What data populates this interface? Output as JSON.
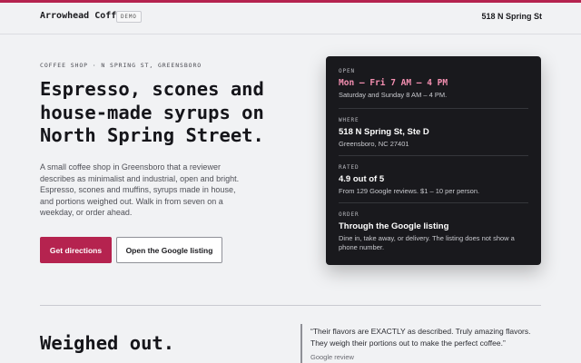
{
  "colors": {
    "accent": "#b5234f",
    "hours_accent": "#f48fb1",
    "card_bg": "#19191d",
    "page_bg": "#f1f2f4"
  },
  "header": {
    "brand": "Arrowhead Coffee",
    "badge": "DEMO",
    "address": "518 N Spring St"
  },
  "hero": {
    "eyebrow": "COFFEE SHOP · N SPRING ST, GREENSBORO",
    "headline": "Espresso, scones and house-made syrups on North Spring Street.",
    "description": "A small coffee shop in Greensboro that a reviewer describes as minimalist and industrial, open and bright. Espresso, scones and muffins, syrups made in house, and portions weighed out. Walk in from seven on a weekday, or order ahead.",
    "primary_button": "Get directions",
    "secondary_button": "Open the Google listing"
  },
  "info_card": {
    "open": {
      "label": "OPEN",
      "main": "Mon – Fri 7 AM – 4 PM",
      "sub": "Saturday and Sunday 8 AM – 4 PM."
    },
    "where": {
      "label": "WHERE",
      "main": "518 N Spring St, Ste D",
      "sub": "Greensboro, NC 27401"
    },
    "rated": {
      "label": "RATED",
      "main": "4.9 out of 5",
      "sub": "From 129 Google reviews. $1 – 10 per person."
    },
    "order": {
      "label": "ORDER",
      "main": "Through the Google listing",
      "sub": "Dine in, take away, or delivery. The listing does not show a phone number."
    }
  },
  "section": {
    "title": "Weighed out.",
    "quote": "“Their flavors are EXACTLY as described. Truly amazing flavors. They weigh their portions out to make the perfect coffee.”",
    "quote_source": "Google review"
  }
}
